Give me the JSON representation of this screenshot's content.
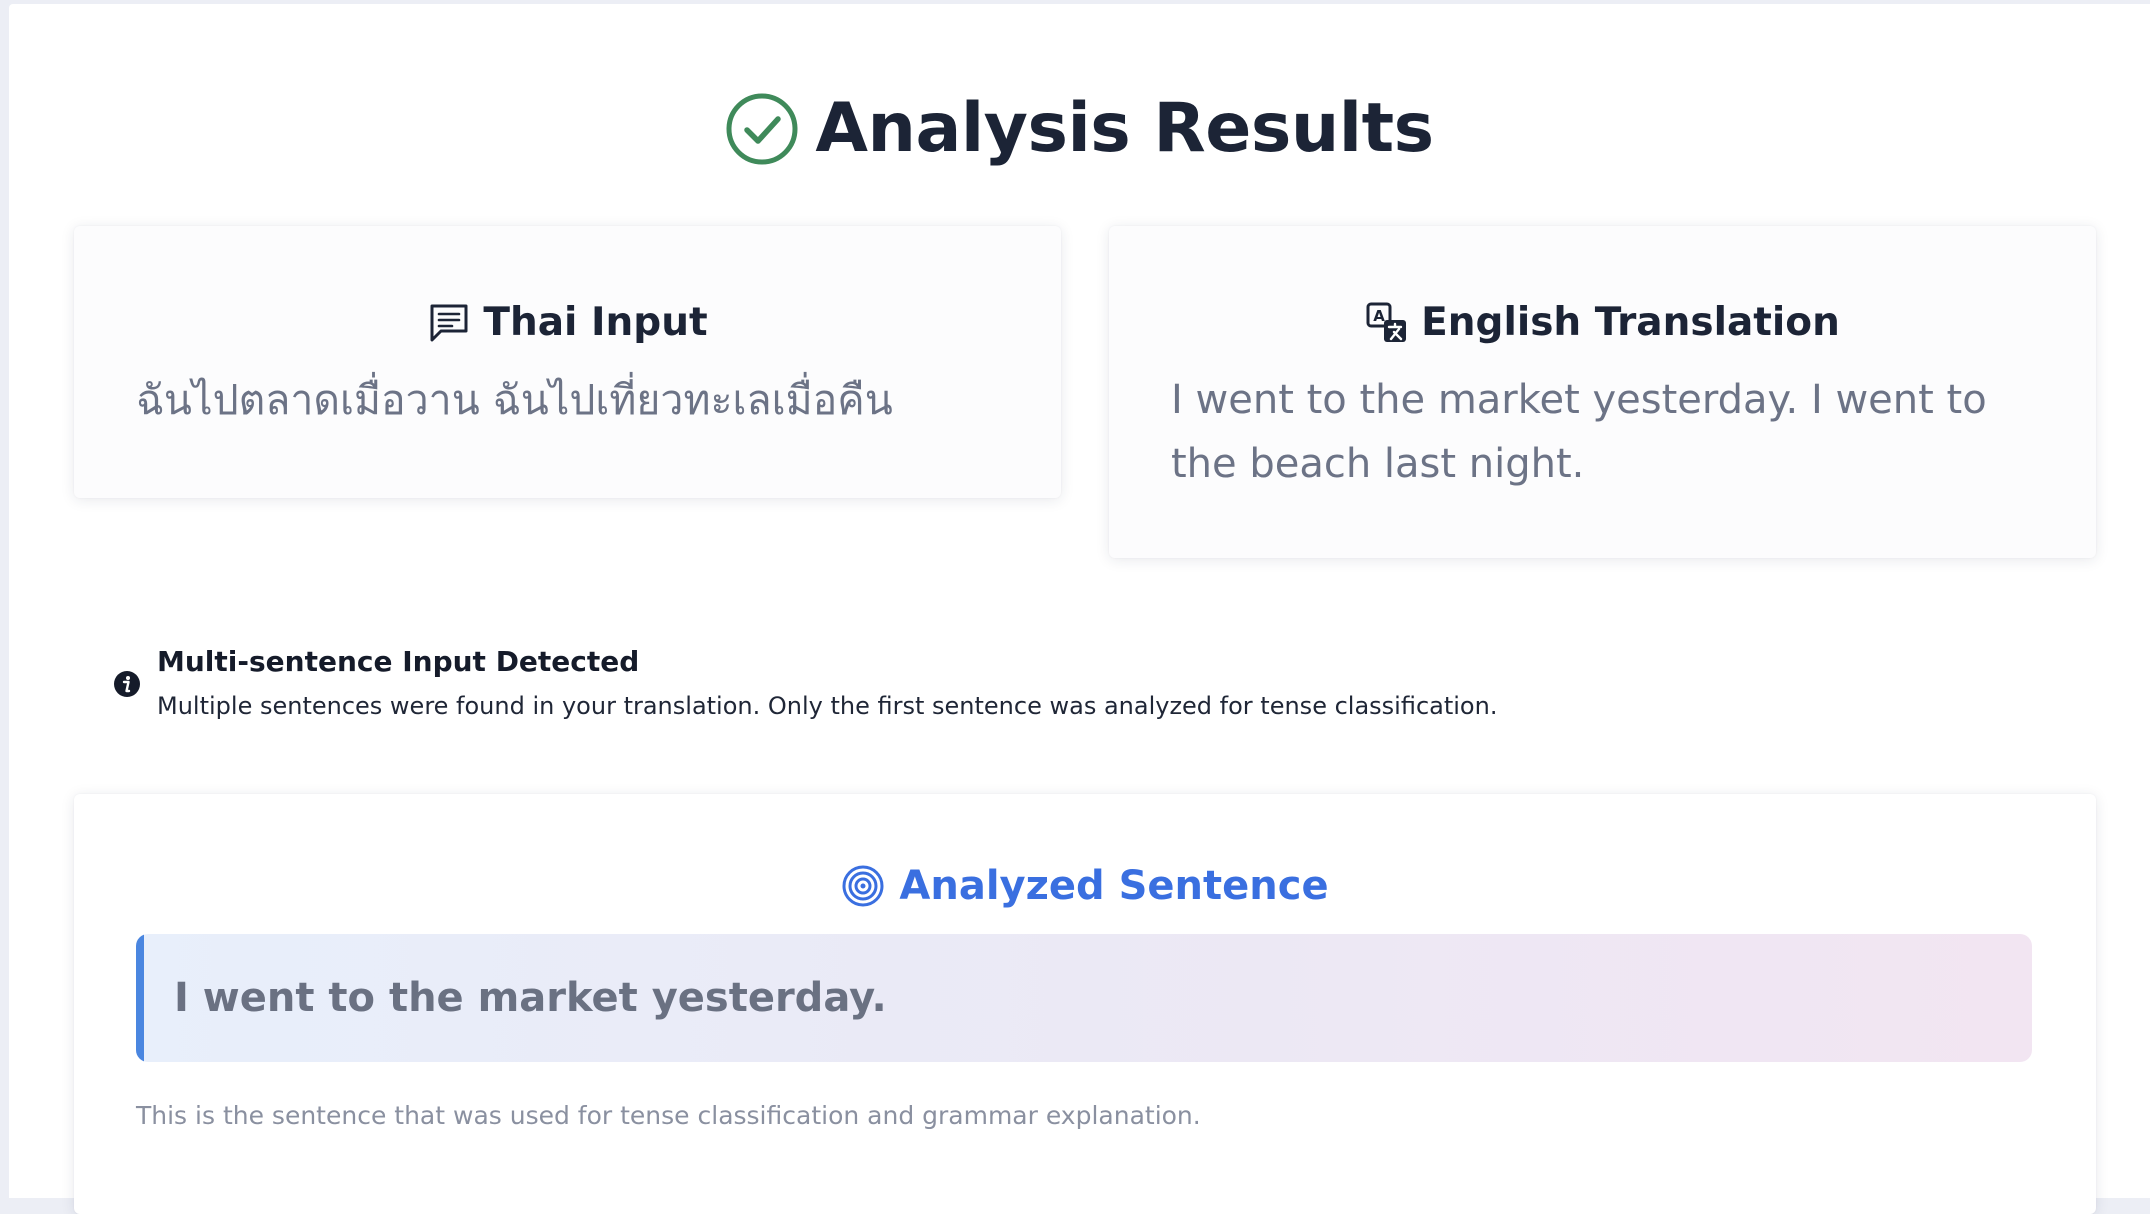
{
  "page": {
    "title": "Analysis Results",
    "title_icon": "check-circle-icon"
  },
  "thai_input": {
    "heading": "Thai Input",
    "icon": "message-square-icon",
    "text": "ฉันไปตลาดเมื่อวาน ฉันไปเที่ยวทะเลเมื่อคืน"
  },
  "english_translation": {
    "heading": "English Translation",
    "icon": "translate-icon",
    "text": "I went to the market yesterday. I went to the beach last night."
  },
  "notice": {
    "icon": "info-icon",
    "title": "Multi-sentence Input Detected",
    "message": "Multiple sentences were found in your translation. Only the first sentence was analyzed for tense classification."
  },
  "analyzed": {
    "heading": "Analyzed Sentence",
    "icon": "target-icon",
    "sentence": "I went to the market yesterday.",
    "caption": "This is the sentence that was used for tense classification and grammar explanation."
  },
  "colors": {
    "success": "#3f8a5a",
    "accent": "#3a6fe0",
    "accent_bar": "#4a86e0",
    "heading": "#1c2436",
    "muted": "#6c7386"
  }
}
